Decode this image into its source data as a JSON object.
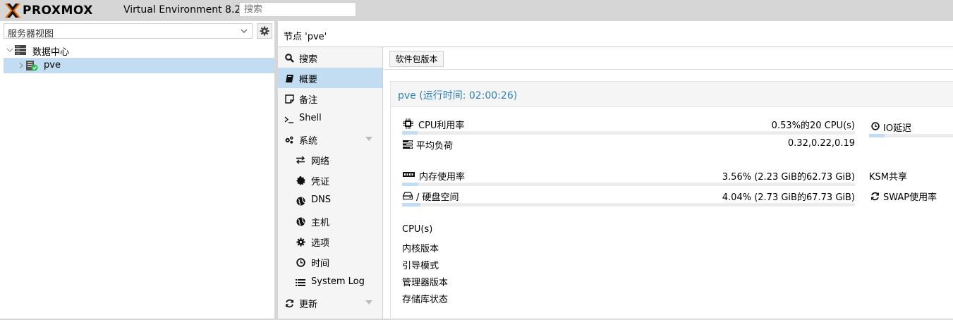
{
  "header": {
    "brand": "PROXMOX",
    "version": "Virtual Environment 8.2.2",
    "search_placeholder": "搜索"
  },
  "left": {
    "view_select": "服务器视图",
    "tree": [
      {
        "label": "数据中心",
        "icon": "server-stack-icon",
        "level": 0
      },
      {
        "label": "pve",
        "icon": "node-online-icon",
        "level": 1,
        "selected": true
      }
    ]
  },
  "main": {
    "node_title": "节点 'pve'",
    "nav": [
      {
        "label": "搜索",
        "icon": "search-icon"
      },
      {
        "label": "概要",
        "icon": "book-icon",
        "active": true
      },
      {
        "label": "备注",
        "icon": "note-icon"
      },
      {
        "label": "Shell",
        "icon": "terminal-icon"
      },
      {
        "label": "系统",
        "icon": "cogs-icon",
        "expandable": true
      },
      {
        "label": "网络",
        "icon": "exchange-icon",
        "sub": true
      },
      {
        "label": "凭证",
        "icon": "certificate-icon",
        "sub": true
      },
      {
        "label": "DNS",
        "icon": "globe-icon",
        "sub": true
      },
      {
        "label": "主机",
        "icon": "globe-icon",
        "sub": true
      },
      {
        "label": "选项",
        "icon": "gear-icon",
        "sub": true
      },
      {
        "label": "时间",
        "icon": "clock-icon",
        "sub": true
      },
      {
        "label": "System Log",
        "icon": "list-icon",
        "sub": true
      },
      {
        "label": "更新",
        "icon": "refresh-icon",
        "expandable": true
      }
    ],
    "toolbar": {
      "pkg_button": "软件包版本"
    },
    "status": {
      "title": "pve (运行时间: 02:00:26)",
      "cpu": {
        "label": "CPU利用率",
        "value": "0.53%的20 CPU(s)",
        "fraction": 0.0053
      },
      "load": {
        "label": "平均负荷",
        "value": "0.32,0.22,0.19"
      },
      "io": {
        "label": "IO延迟",
        "fraction": 0.0
      },
      "memory": {
        "label": "内存使用率",
        "value": "3.56% (2.23 GiB的62.73 GiB)",
        "fraction": 0.0356
      },
      "ksm": {
        "label": "KSM共享"
      },
      "disk": {
        "label": "/ 硬盘空间",
        "value": "4.04% (2.73 GiB的67.73 GiB)",
        "fraction": 0.0404
      },
      "swap": {
        "label": "SWAP使用率"
      },
      "info": [
        "CPU(s)",
        "内核版本",
        "引导模式",
        "管理器版本",
        "存储库状态"
      ]
    }
  },
  "colors": {
    "accent": "#2e7fba",
    "selected": "#c2ddf2",
    "logo_orange": "#e57000"
  }
}
